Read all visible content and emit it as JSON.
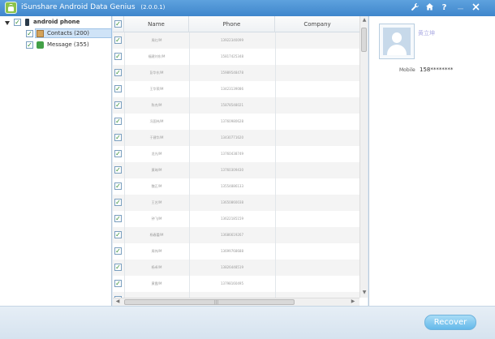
{
  "app": {
    "title": "iSunshare Android Data Genius",
    "version": "(2.0.0.1)",
    "icons": [
      "wrench-icon",
      "home-icon",
      "help-icon",
      "minimize-icon",
      "close-icon"
    ]
  },
  "tree": {
    "root": {
      "label": "android phone",
      "checked": true,
      "icon": "phone-icon"
    },
    "items": [
      {
        "label": "Contacts (200)",
        "checked": true,
        "selected": true,
        "icon": "contacts-icon"
      },
      {
        "label": "Message (355)",
        "checked": true,
        "selected": false,
        "icon": "message-icon"
      }
    ]
  },
  "grid": {
    "columns": [
      "Name",
      "Phone",
      "Company"
    ],
    "rows": [
      {
        "name": "周红/M",
        "phone": "13922340099",
        "company": ""
      },
      {
        "name": "福建刘东/M",
        "phone": "15817425348",
        "company": ""
      },
      {
        "name": "彭华东/M",
        "phone": "15989548478",
        "company": ""
      },
      {
        "name": "王华荣/M",
        "phone": "13423139086",
        "company": ""
      },
      {
        "name": "陈杰/M",
        "phone": "15878548021",
        "company": ""
      },
      {
        "name": "冯国伟/M",
        "phone": "13760980628",
        "company": ""
      },
      {
        "name": "于建华/M",
        "phone": "13430771620",
        "company": ""
      },
      {
        "name": "龙光/M",
        "phone": "13760438749",
        "company": ""
      },
      {
        "name": "黄琦/M",
        "phone": "13760309430",
        "company": ""
      },
      {
        "name": "魏正/M",
        "phone": "13554886133",
        "company": ""
      },
      {
        "name": "王艺/M",
        "phone": "13650860038",
        "company": ""
      },
      {
        "name": "钟飞/M",
        "phone": "13622185159",
        "company": ""
      },
      {
        "name": "杨春蕾/M",
        "phone": "13686619267",
        "company": ""
      },
      {
        "name": "周伟/M",
        "phone": "13699768688",
        "company": ""
      },
      {
        "name": "杨卓/M",
        "phone": "13826448519",
        "company": ""
      },
      {
        "name": "黄霞/M",
        "phone": "13798160495",
        "company": ""
      },
      {
        "name": "曹伟/M",
        "phone": "13620732380",
        "company": ""
      },
      {
        "name": "刘建伟/M",
        "phone": "13612345678",
        "company": ""
      }
    ]
  },
  "detail": {
    "name": "黄立坤",
    "mobile_label": "Mobile",
    "mobile_value": "158********"
  },
  "footer": {
    "recover_label": "Recover"
  }
}
